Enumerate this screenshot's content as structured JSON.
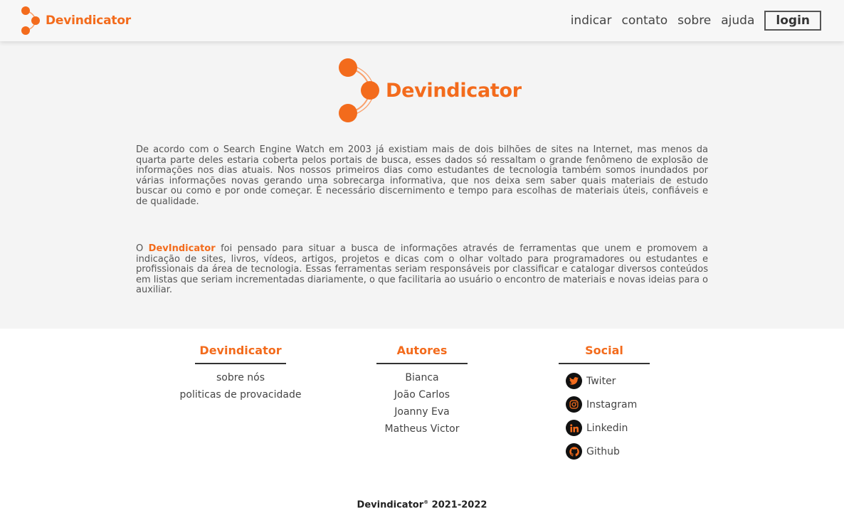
{
  "header": {
    "brand": "Devindicator",
    "nav": [
      "indicar",
      "contato",
      "sobre",
      "ajuda"
    ],
    "login": "login"
  },
  "hero": {
    "logo_text": "Devindicator",
    "paragraph1": "De acordo com o Search Engine Watch em 2003 já existiam mais de dois bilhões de sites na Internet, mas menos da quarta parte deles estaria coberta pelos portais de busca, esses dados só ressaltam o grande fenômeno de explosão de informações nos dias atuais. Nos nossos primeiros dias como estudantes de tecnologia também somos inundados por várias informações novas gerando uma sobrecarga informativa, que nos deixa sem saber quais materiais de estudo buscar ou como e por onde começar. É necessário discernimento e tempo para escolhas de materiais úteis, confiáveis e de qualidade.",
    "paragraph2_prefix": "O",
    "paragraph2_highlight": "DevIndicator",
    "paragraph2_rest": "foi pensado para situar a busca de informações através de ferramentas que unem e promovem a indicação de sites, livros, vídeos, artigos, projetos e dicas com o olhar voltado para programadores ou estudantes e profissionais da área de tecnologia. Essas ferramentas seriam responsáveis por classificar e catalogar diversos conteúdos em listas que seriam incrementadas diariamente, o que facilitaria ao usuário o encontro de materiais e novas ideias para o auxiliar."
  },
  "footer": {
    "col1": {
      "title": "Devindicator",
      "links": [
        "sobre nós",
        "politicas de provacidade"
      ]
    },
    "col2": {
      "title": "Autores",
      "links": [
        "Bianca",
        "João Carlos",
        "Joanny Eva",
        "Matheus Victor"
      ]
    },
    "col3": {
      "title": "Social",
      "links": [
        "Twiter",
        "Instagram",
        "Linkedin",
        "Github"
      ]
    },
    "copyright_brand": "Devindicator",
    "copyright_mark": "®",
    "copyright_years": "2021-2022"
  },
  "colors": {
    "accent": "#f36b1c",
    "hero_bg": "#f4f4f4",
    "header_bg": "#f7f7f7"
  },
  "icons": [
    "twitter-icon",
    "instagram-icon",
    "linkedin-icon",
    "github-icon"
  ]
}
